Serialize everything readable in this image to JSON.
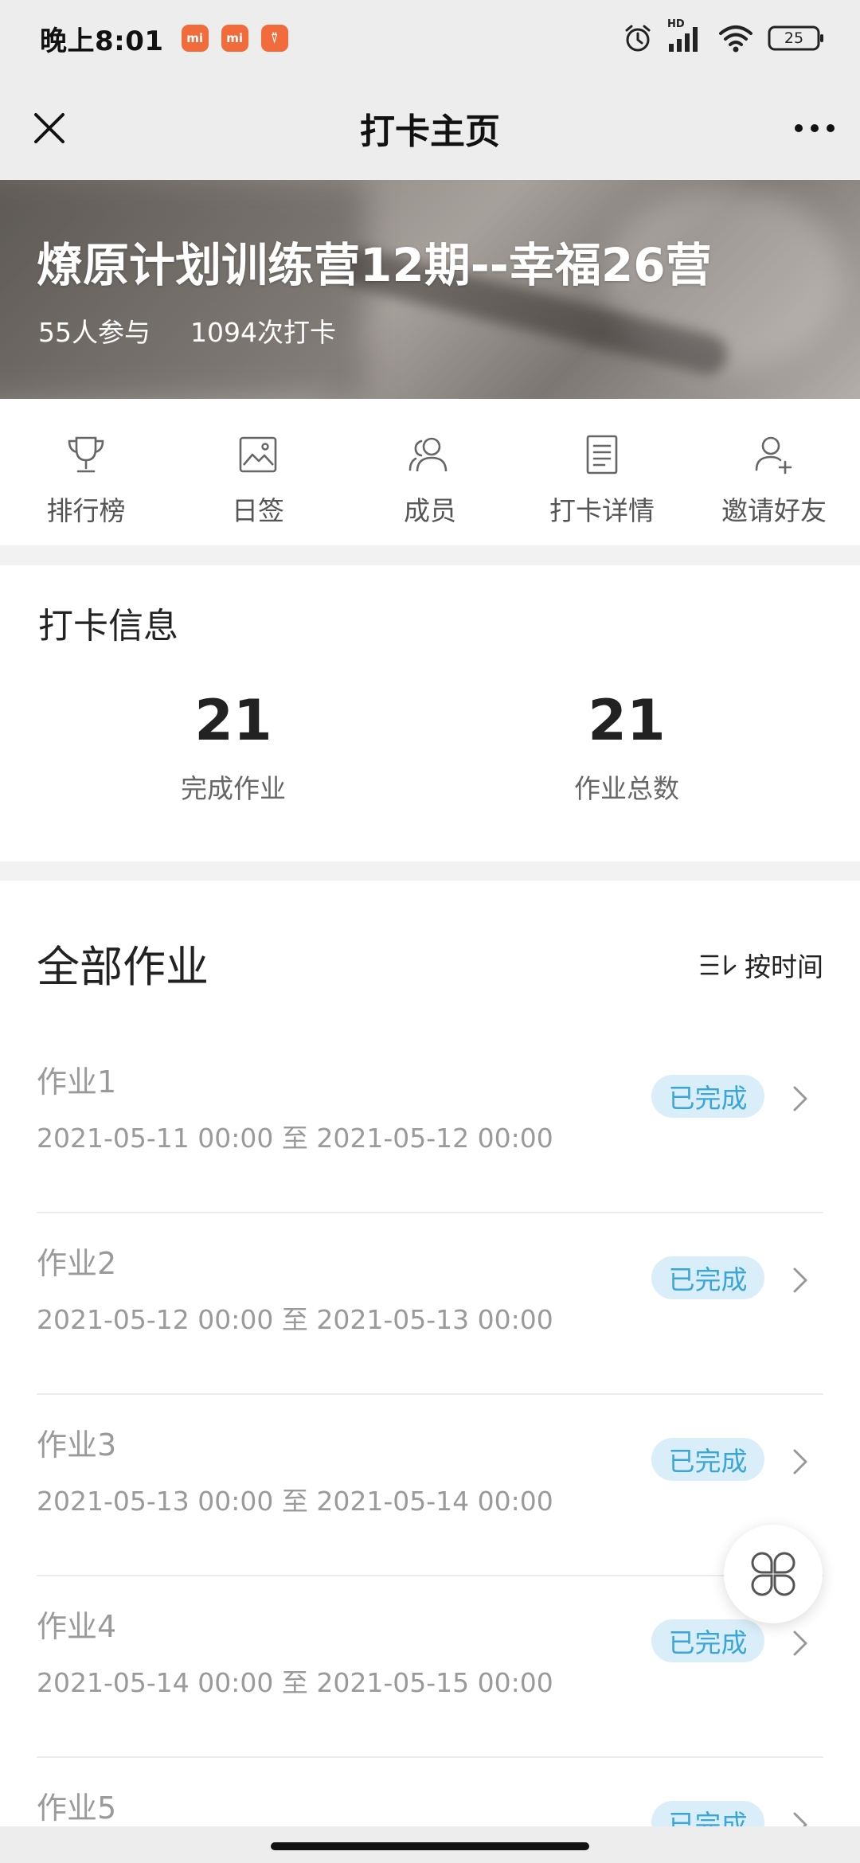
{
  "status_bar": {
    "time": "晚上8:01",
    "notif_icons": [
      "mi-app-icon",
      "mi-app-icon",
      "mi-store-icon"
    ],
    "badge_texts": [
      "mi",
      "mi",
      "⍢"
    ],
    "network_label": "HD",
    "battery": "25"
  },
  "navbar": {
    "title": "打卡主页"
  },
  "banner": {
    "title": "燎原计划训练营12期--幸福26营",
    "participants": "55人参与",
    "checkins": "1094次打卡"
  },
  "actions": [
    {
      "label": "排行榜",
      "icon": "trophy-icon"
    },
    {
      "label": "日签",
      "icon": "image-icon"
    },
    {
      "label": "成员",
      "icon": "members-icon"
    },
    {
      "label": "打卡详情",
      "icon": "document-icon"
    },
    {
      "label": "邀请好友",
      "icon": "add-friend-icon"
    }
  ],
  "checkin_info": {
    "title": "打卡信息",
    "completed": {
      "value": "21",
      "label": "完成作业"
    },
    "total": {
      "value": "21",
      "label": "作业总数"
    }
  },
  "homework": {
    "title": "全部作业",
    "sort_label": "按时间",
    "items": [
      {
        "name": "作业1",
        "range": "2021-05-11 00:00 至 2021-05-12 00:00",
        "status": "已完成"
      },
      {
        "name": "作业2",
        "range": "2021-05-12 00:00 至 2021-05-13 00:00",
        "status": "已完成"
      },
      {
        "name": "作业3",
        "range": "2021-05-13 00:00 至 2021-05-14 00:00",
        "status": "已完成"
      },
      {
        "name": "作业4",
        "range": "2021-05-14 00:00 至 2021-05-15 00:00",
        "status": "已完成"
      },
      {
        "name": "作业5",
        "range": "",
        "status": "已完成"
      }
    ]
  },
  "colors": {
    "badge_bg": "#d9eef8",
    "badge_text": "#3aa5d8",
    "mi_orange": "#f26b3a"
  }
}
